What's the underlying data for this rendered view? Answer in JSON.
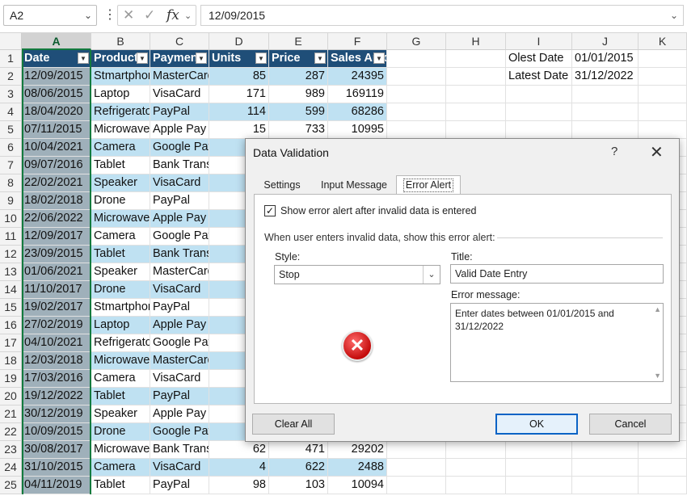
{
  "formula_bar": {
    "name_box": "A2",
    "fx_label": "fx",
    "formula_value": "12/09/2015"
  },
  "columns": [
    "A",
    "B",
    "C",
    "D",
    "E",
    "F",
    "G",
    "H",
    "I",
    "J",
    "K"
  ],
  "table": {
    "headers": [
      "Date",
      "Product",
      "Payment",
      "Units",
      "Price",
      "Sales Amount"
    ],
    "rows": [
      [
        "12/09/2015",
        "Stmartphone",
        "MasterCard",
        "85",
        "287",
        "24395"
      ],
      [
        "08/06/2015",
        "Laptop",
        "VisaCard",
        "171",
        "989",
        "169119"
      ],
      [
        "18/04/2020",
        "Refrigerator",
        "PayPal",
        "114",
        "599",
        "68286"
      ],
      [
        "07/11/2015",
        "Microwave",
        "Apple Pay",
        "15",
        "733",
        "10995"
      ],
      [
        "10/04/2021",
        "Camera",
        "Google Pay",
        "",
        "",
        ""
      ],
      [
        "09/07/2016",
        "Tablet",
        "Bank Transfer",
        "",
        "",
        ""
      ],
      [
        "22/02/2021",
        "Speaker",
        "VisaCard",
        "",
        "",
        ""
      ],
      [
        "18/02/2018",
        "Drone",
        "PayPal",
        "",
        "",
        ""
      ],
      [
        "22/06/2022",
        "Microwave",
        "Apple Pay",
        "",
        "",
        ""
      ],
      [
        "12/09/2017",
        "Camera",
        "Google Pay",
        "",
        "",
        ""
      ],
      [
        "23/09/2015",
        "Tablet",
        "Bank Transfer",
        "",
        "",
        ""
      ],
      [
        "01/06/2021",
        "Speaker",
        "MasterCard",
        "",
        "",
        ""
      ],
      [
        "11/10/2017",
        "Drone",
        "VisaCard",
        "",
        "",
        ""
      ],
      [
        "19/02/2017",
        "Stmartphone",
        "PayPal",
        "",
        "",
        ""
      ],
      [
        "27/02/2019",
        "Laptop",
        "Apple Pay",
        "",
        "",
        ""
      ],
      [
        "04/10/2021",
        "Refrigerator",
        "Google Pay",
        "",
        "",
        ""
      ],
      [
        "12/03/2018",
        "Microwave",
        "MasterCard",
        "",
        "",
        ""
      ],
      [
        "17/03/2016",
        "Camera",
        "VisaCard",
        "",
        "",
        ""
      ],
      [
        "19/12/2022",
        "Tablet",
        "PayPal",
        "",
        "",
        ""
      ],
      [
        "30/12/2019",
        "Speaker",
        "Apple Pay",
        "",
        "",
        ""
      ],
      [
        "10/09/2015",
        "Drone",
        "Google Pay",
        "",
        "",
        ""
      ],
      [
        "30/08/2017",
        "Microwave",
        "Bank Transfer",
        "62",
        "471",
        "29202"
      ],
      [
        "31/10/2015",
        "Camera",
        "VisaCard",
        "4",
        "622",
        "2488"
      ],
      [
        "04/11/2019",
        "Tablet",
        "PayPal",
        "98",
        "103",
        "10094"
      ]
    ]
  },
  "side": {
    "oldest_label": "Olest Date",
    "oldest_value": "01/01/2015",
    "latest_label": "Latest Date",
    "latest_value": "31/12/2022"
  },
  "dialog": {
    "title": "Data Validation",
    "help": "?",
    "close": "✕",
    "tabs": [
      "Settings",
      "Input Message",
      "Error Alert"
    ],
    "active_tab": "Error Alert",
    "show_alert_label": "Show error alert after invalid data is entered",
    "show_alert_checked": true,
    "when_label": "When user enters invalid data, show this error alert:",
    "style_label": "Style:",
    "style_value": "Stop",
    "title_label": "Title:",
    "title_value": "Valid Date Entry",
    "message_label": "Error message:",
    "message_value": "Enter dates between 01/01/2015 and 31/12/2022",
    "clear_all": "Clear All",
    "ok": "OK",
    "cancel": "Cancel"
  },
  "colors": {
    "header_bg": "#1f4e78",
    "band_bg": "#bfe1f2",
    "selection": "#137a3e",
    "ok_border": "#0b63c5"
  }
}
